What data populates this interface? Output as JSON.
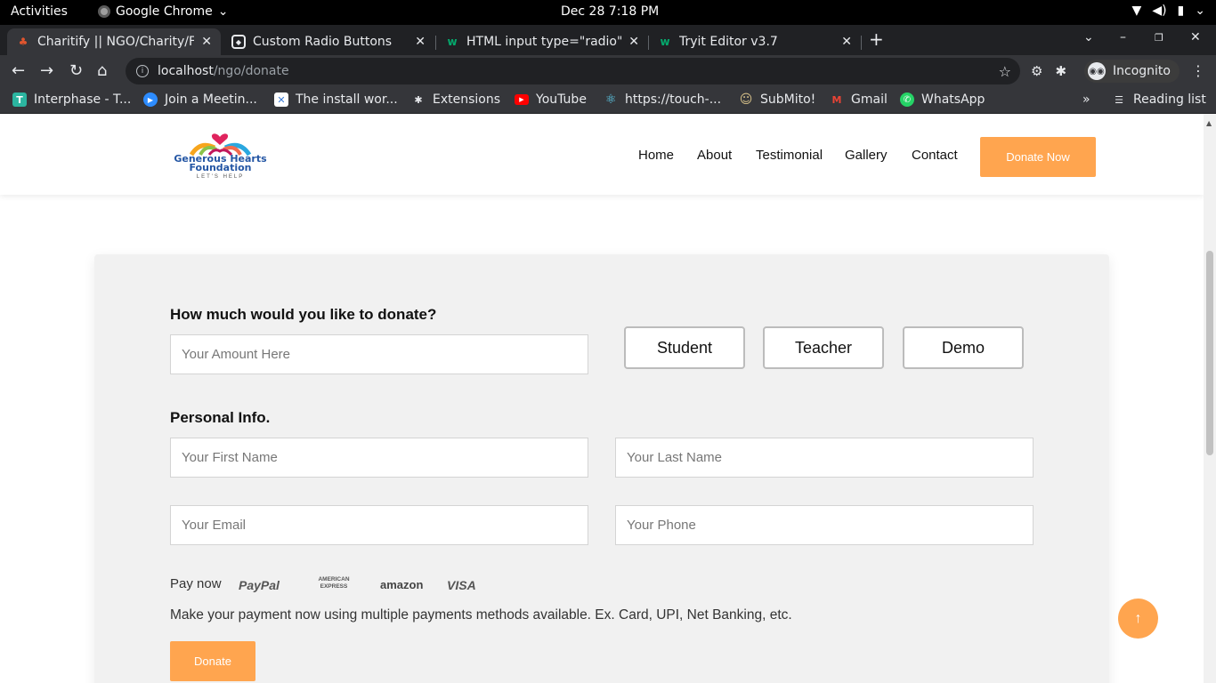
{
  "system": {
    "activities": "Activities",
    "app_name": "Google Chrome",
    "clock": "Dec 28  7:18 PM"
  },
  "tabs": [
    {
      "title": "Charitify || NGO/Charity/F",
      "active": true
    },
    {
      "title": "Custom Radio Buttons",
      "active": false
    },
    {
      "title": "HTML input type=\"radio\"",
      "active": false
    },
    {
      "title": "Tryit Editor v3.7",
      "active": false
    }
  ],
  "address": {
    "host": "localhost",
    "path": "/ngo/donate",
    "incognito_label": "Incognito"
  },
  "bookmarks": [
    {
      "label": "Interphase - T...",
      "icon_text": "T",
      "color": "#2bb5a0"
    },
    {
      "label": "Join a Meetin...",
      "icon_text": "▶",
      "color": "#2d8cff"
    },
    {
      "label": "The install wor...",
      "icon_text": "✕",
      "color": "#3a7bd5"
    },
    {
      "label": "Extensions",
      "icon_text": "✱",
      "color": "#e8eaed"
    },
    {
      "label": "YouTube",
      "icon_text": "▶",
      "color": "#ff0000"
    },
    {
      "label": "https://touch-...",
      "icon_text": "⚛",
      "color": "#61dafb"
    },
    {
      "label": "SubMito!",
      "icon_text": "☺",
      "color": "#d8c28a"
    },
    {
      "label": "Gmail",
      "icon_text": "M",
      "color": "#ea4335"
    },
    {
      "label": "WhatsApp",
      "icon_text": "✆",
      "color": "#25d366"
    }
  ],
  "reading_list": "Reading list",
  "site": {
    "logo": {
      "line1": "Generous Hearts",
      "line2": "Foundation",
      "tagline": "LET'S HELP"
    },
    "nav": [
      "Home",
      "About",
      "Testimonial",
      "Gallery",
      "Contact"
    ],
    "donate_now": "Donate Now",
    "accent_color": "#ffa54f"
  },
  "form": {
    "amount_heading": "How much would you like to donate?",
    "amount_placeholder": "Your Amount Here",
    "options": [
      "Student",
      "Teacher",
      "Demo"
    ],
    "personal_heading": "Personal Info.",
    "first_name_placeholder": "Your First Name",
    "last_name_placeholder": "Your Last Name",
    "email_placeholder": "Your Email",
    "phone_placeholder": "Your Phone",
    "pay_now": "Pay now",
    "pay_logos": [
      "PayPal",
      "AMERICAN EXPRESS",
      "amazon",
      "VISA"
    ],
    "pay_description": "Make your payment now using multiple payments methods available. Ex. Card, UPI, Net Banking, etc.",
    "donate_button": "Donate"
  },
  "scroll_top_icon": "↑"
}
